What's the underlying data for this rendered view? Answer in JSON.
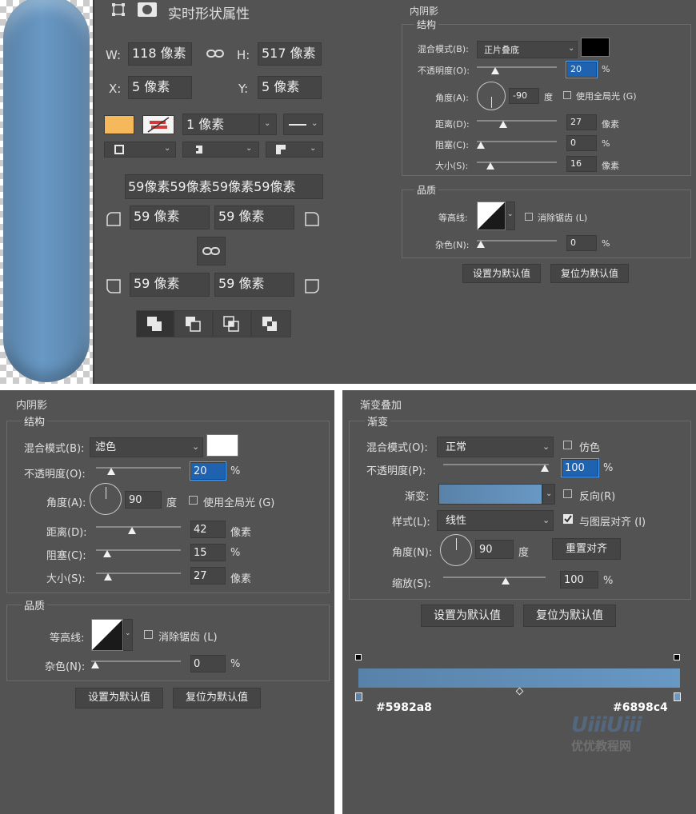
{
  "colors": {
    "panel": "#535353",
    "field": "#454545",
    "fill_swatch": "#f5b85a",
    "grad_start": "#5982a8",
    "grad_end": "#6898c4",
    "shadow_black": "#000000",
    "screen_white": "#ffffff"
  },
  "props": {
    "title": "实时形状属性",
    "w_label": "W:",
    "w_value": "118 像素",
    "h_label": "H:",
    "h_value": "517 像素",
    "x_label": "X:",
    "x_value": "5 像素",
    "y_label": "Y:",
    "y_value": "5 像素",
    "stroke_width": "1 像素",
    "radii_all": "59像素59像素59像素59像素",
    "r_tl": "59 像素",
    "r_tr": "59 像素",
    "r_bl": "59 像素",
    "r_br": "59 像素",
    "icons": [
      "transform-icon",
      "mask-icon",
      "link-icon",
      "corner-icon",
      "align-icon",
      "combine-icon"
    ]
  },
  "inner1": {
    "title": "内阴影",
    "structure": "结构",
    "blend_label": "混合模式(B):",
    "blend_value": "正片叠底",
    "opacity_label": "不透明度(O):",
    "opacity_value": "20",
    "opacity_unit": "%",
    "angle_label": "角度(A):",
    "angle_value": "-90",
    "angle_unit": "度",
    "global_light": "使用全局光 (G)",
    "distance_label": "距离(D):",
    "distance_value": "27",
    "distance_unit": "像素",
    "choke_label": "阻塞(C):",
    "choke_value": "0",
    "choke_unit": "%",
    "size_label": "大小(S):",
    "size_value": "16",
    "size_unit": "像素",
    "quality": "品质",
    "contour_label": "等高线:",
    "antialias": "消除锯齿 (L)",
    "noise_label": "杂色(N):",
    "noise_value": "0",
    "noise_unit": "%",
    "default_btn": "设置为默认值",
    "reset_btn": "复位为默认值"
  },
  "inner2": {
    "title": "内阴影",
    "structure": "结构",
    "blend_label": "混合模式(B):",
    "blend_value": "滤色",
    "opacity_label": "不透明度(O):",
    "opacity_value": "20",
    "opacity_unit": "%",
    "angle_label": "角度(A):",
    "angle_value": "90",
    "angle_unit": "度",
    "global_light": "使用全局光 (G)",
    "distance_label": "距离(D):",
    "distance_value": "42",
    "distance_unit": "像素",
    "choke_label": "阻塞(C):",
    "choke_value": "15",
    "choke_unit": "%",
    "size_label": "大小(S):",
    "size_value": "27",
    "size_unit": "像素",
    "quality": "品质",
    "contour_label": "等高线:",
    "antialias": "消除锯齿 (L)",
    "noise_label": "杂色(N):",
    "noise_value": "0",
    "noise_unit": "%",
    "default_btn": "设置为默认值",
    "reset_btn": "复位为默认值"
  },
  "gradient": {
    "title": "渐变叠加",
    "sub": "渐变",
    "blend_label": "混合模式(O):",
    "blend_value": "正常",
    "dither": "仿色",
    "opacity_label": "不透明度(P):",
    "opacity_value": "100",
    "opacity_unit": "%",
    "gradient_label": "渐变:",
    "reverse": "反向(R)",
    "style_label": "样式(L):",
    "style_value": "线性",
    "align": "与图层对齐 (I)",
    "angle_label": "角度(N):",
    "angle_value": "90",
    "angle_unit": "度",
    "reset_align": "重置对齐",
    "scale_label": "缩放(S):",
    "scale_value": "100",
    "scale_unit": "%",
    "default_btn": "设置为默认值",
    "reset_btn": "复位为默认值",
    "stop_left": "#5982a8",
    "stop_right": "#6898c4",
    "watermark_main": "UiiiUiii",
    "watermark_sub": "优优教程网"
  }
}
